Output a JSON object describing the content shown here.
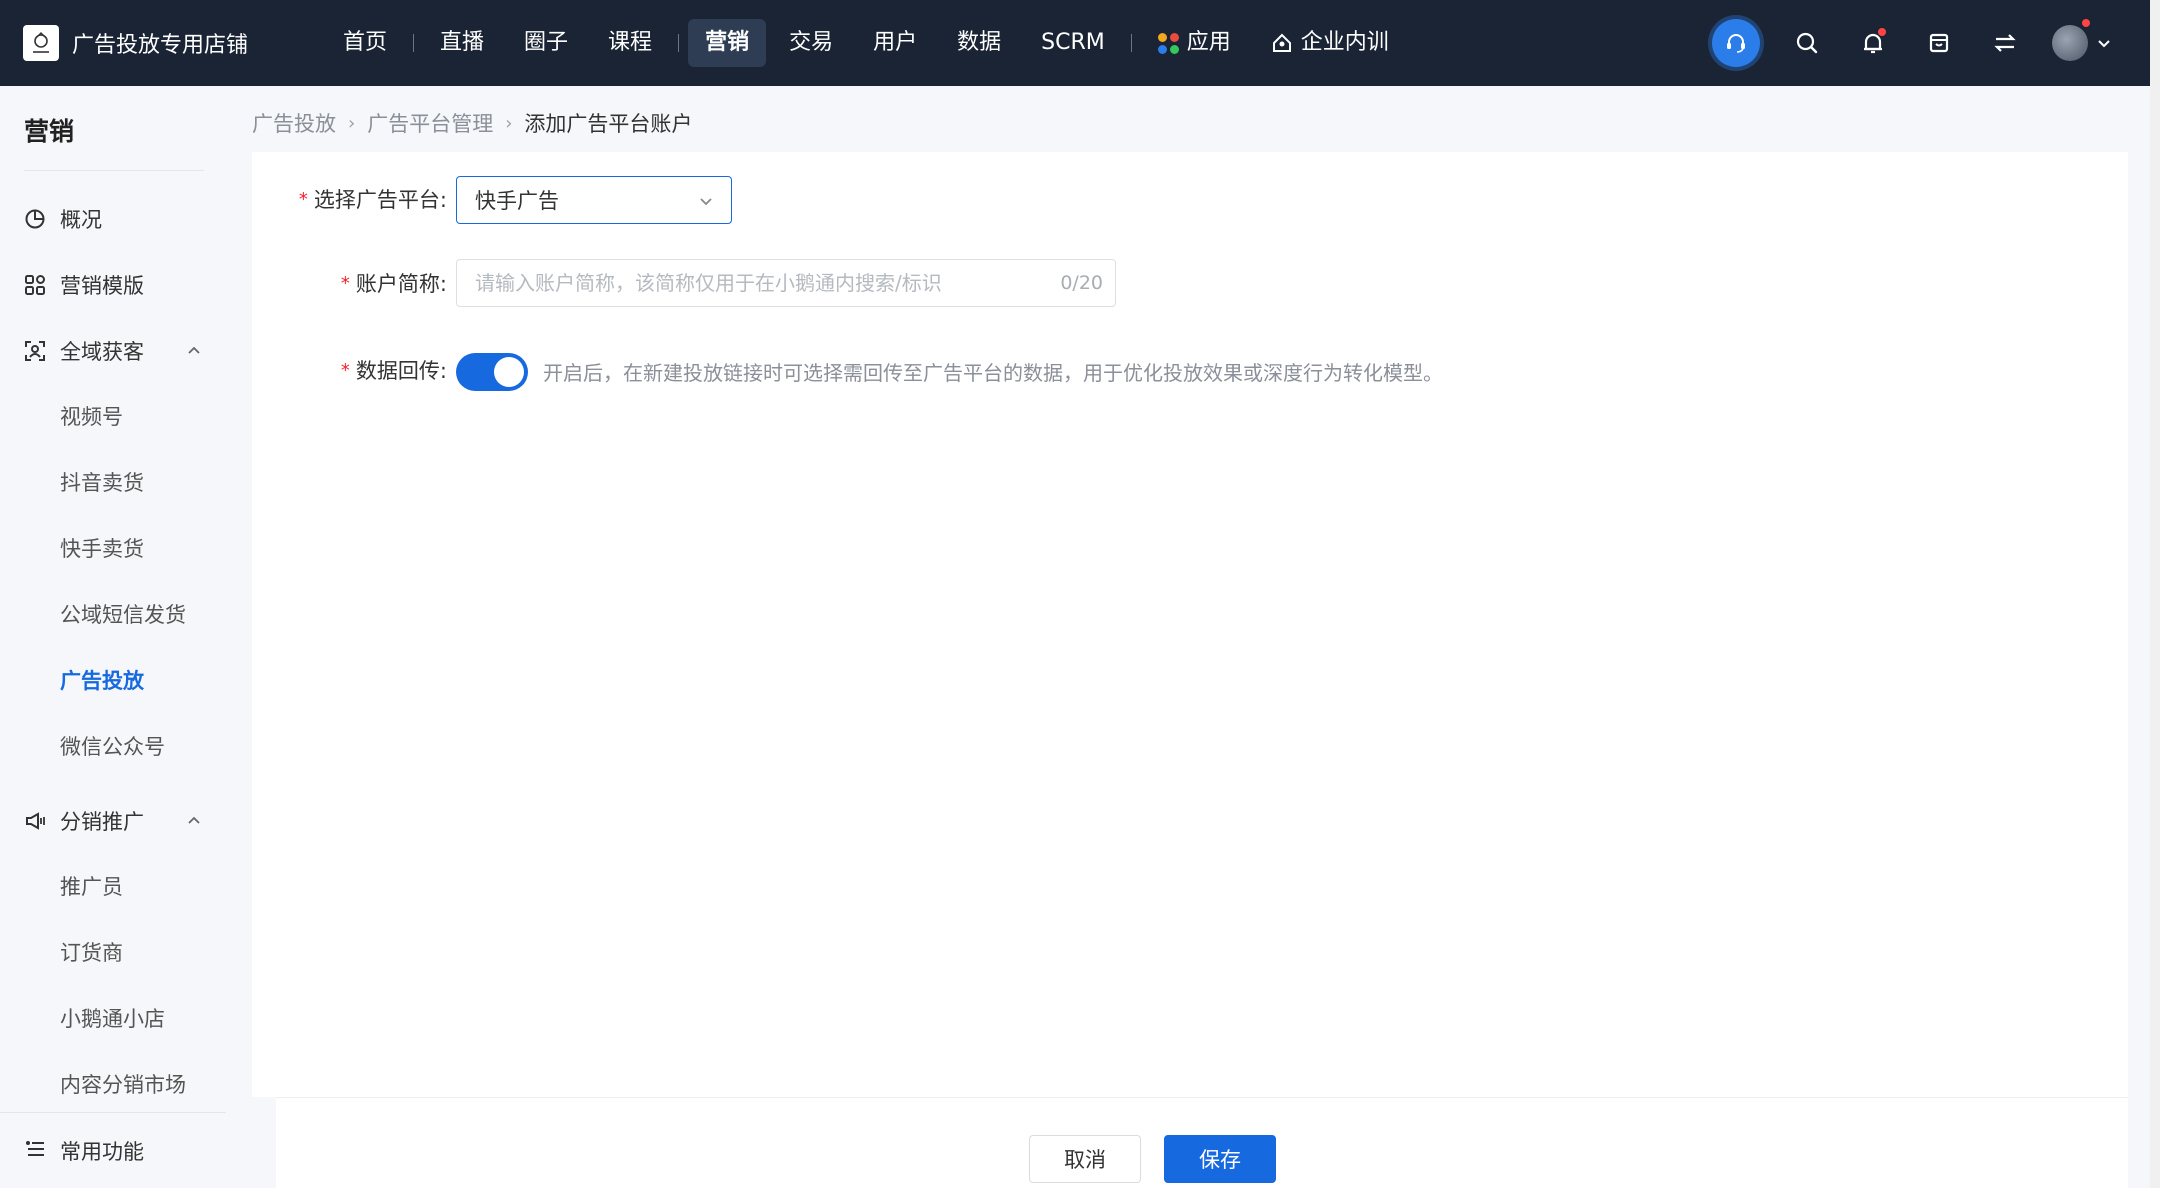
{
  "store": {
    "name": "广告投放专用店铺",
    "logo_icon": "store-logo-icon"
  },
  "nav": {
    "items": [
      {
        "label": "首页",
        "active": false
      },
      {
        "label": "直播",
        "active": false
      },
      {
        "label": "圈子",
        "active": false
      },
      {
        "label": "课程",
        "active": false
      },
      {
        "label": "营销",
        "active": true
      },
      {
        "label": "交易",
        "active": false
      },
      {
        "label": "用户",
        "active": false
      },
      {
        "label": "数据",
        "active": false
      },
      {
        "label": "SCRM",
        "active": false
      }
    ],
    "apps_label": "应用",
    "training_label": "企业内训"
  },
  "sidebar": {
    "title": "营销",
    "items": [
      {
        "label": "概况",
        "icon": "pie-chart-icon"
      },
      {
        "label": "营销模版",
        "icon": "grid-icon"
      },
      {
        "label": "全域获客",
        "icon": "user-scan-icon",
        "expanded": true,
        "children": [
          "视频号",
          "抖音卖货",
          "快手卖货",
          "公域短信发货",
          "广告投放",
          "微信公众号"
        ]
      },
      {
        "label": "分销推广",
        "icon": "megaphone-icon",
        "expanded": true,
        "children": [
          "推广员",
          "订货商",
          "小鹅通小店",
          "内容分销市场"
        ]
      }
    ],
    "active_child": "广告投放",
    "common": "常用功能"
  },
  "breadcrumb": [
    "广告投放",
    "广告平台管理",
    "添加广告平台账户"
  ],
  "form": {
    "platform": {
      "label": "选择广告平台:",
      "value": "快手广告"
    },
    "alias": {
      "label": "账户简称:",
      "placeholder": "请输入账户简称，该简称仅用于在小鹅通内搜索/标识",
      "count": "0/20"
    },
    "callback": {
      "label": "数据回传:",
      "enabled": true,
      "hint": "开启后，在新建投放链接时可选择需回传至广告平台的数据，用于优化投放效果或深度行为转化模型。"
    }
  },
  "footer": {
    "cancel": "取消",
    "save": "保存"
  },
  "colors": {
    "primary": "#1769e0",
    "topbar": "#1a2435",
    "required": "#f5222d"
  }
}
